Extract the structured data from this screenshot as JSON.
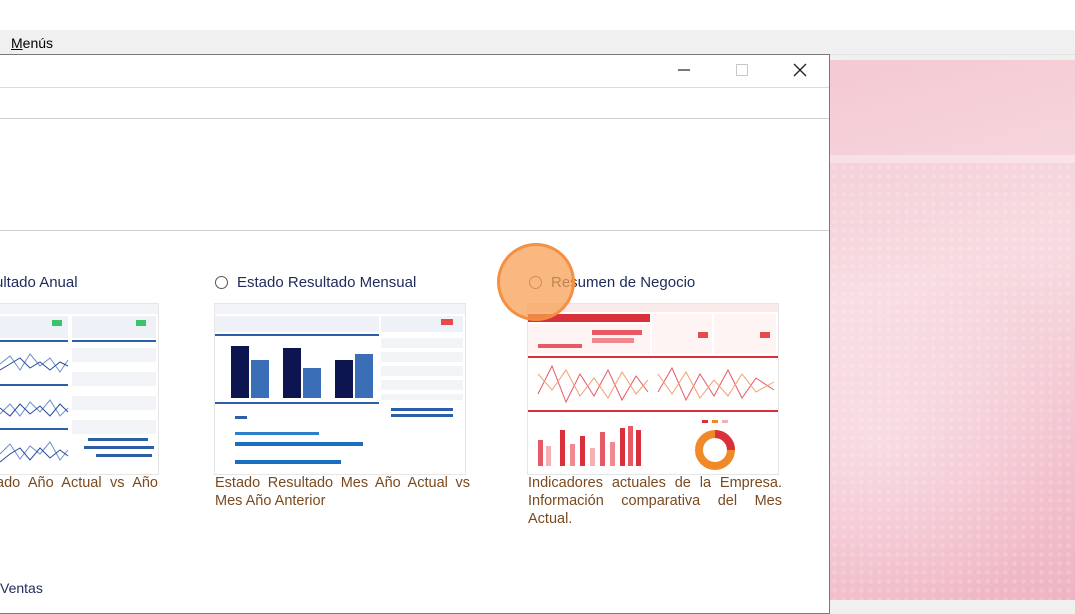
{
  "menubar": {
    "menu_label": "Menús"
  },
  "dialog": {
    "controls": {
      "minimize_icon": "minimize-icon",
      "maximize_icon": "maximize-icon",
      "close_icon": "close-icon"
    },
    "options": [
      {
        "label": "ultado Anual",
        "selected": false,
        "description": "ado Año Actual vs Año"
      },
      {
        "label": "Estado Resultado Mensual",
        "selected": false,
        "description_line1": "Estado Resultado Mes Año Actual vs",
        "description_line2": "Mes Año Anterior"
      },
      {
        "label": "Resumen de Negocio",
        "selected": false,
        "description_line1": "Indicadores actuales de la Empresa.",
        "description_line2": "Información comparativa del Mes",
        "description_line3": "Actual."
      }
    ],
    "next_option_label": "Ventas"
  },
  "colors": {
    "option_text": "#1e2a5a",
    "description_text": "#7a4a1e",
    "accent_red": "#d9303c",
    "chart_navy": "#0d1550",
    "chart_blue": "#3a6fb8",
    "click_marker": "#f7a055"
  }
}
